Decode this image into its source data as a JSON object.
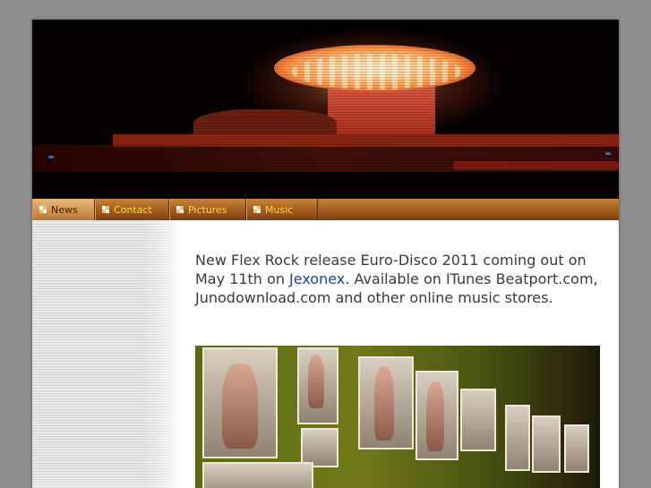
{
  "nav": {
    "items": [
      {
        "label": "News",
        "active": true
      },
      {
        "label": "Contact",
        "active": false
      },
      {
        "label": "Pictures",
        "active": false
      },
      {
        "label": "Music",
        "active": false
      }
    ]
  },
  "news": {
    "text_before_link": "New Flex Rock release Euro-Disco 2011 coming out on May 11th on ",
    "link_label": "Jexonex",
    "text_after_link": ". Available on ITunes Beatport.com, Junodownload.com and other online music stores."
  },
  "colors": {
    "page_background": "#8e8e8e",
    "nav_gradient_top": "#c9853a",
    "nav_gradient_bottom": "#7a4210",
    "nav_text": "#ffd94a",
    "link": "#1f3f8f",
    "photo_banner_text": "#c44ad0"
  },
  "icons": {
    "nav_bullet": "menu-bullet-icon"
  }
}
